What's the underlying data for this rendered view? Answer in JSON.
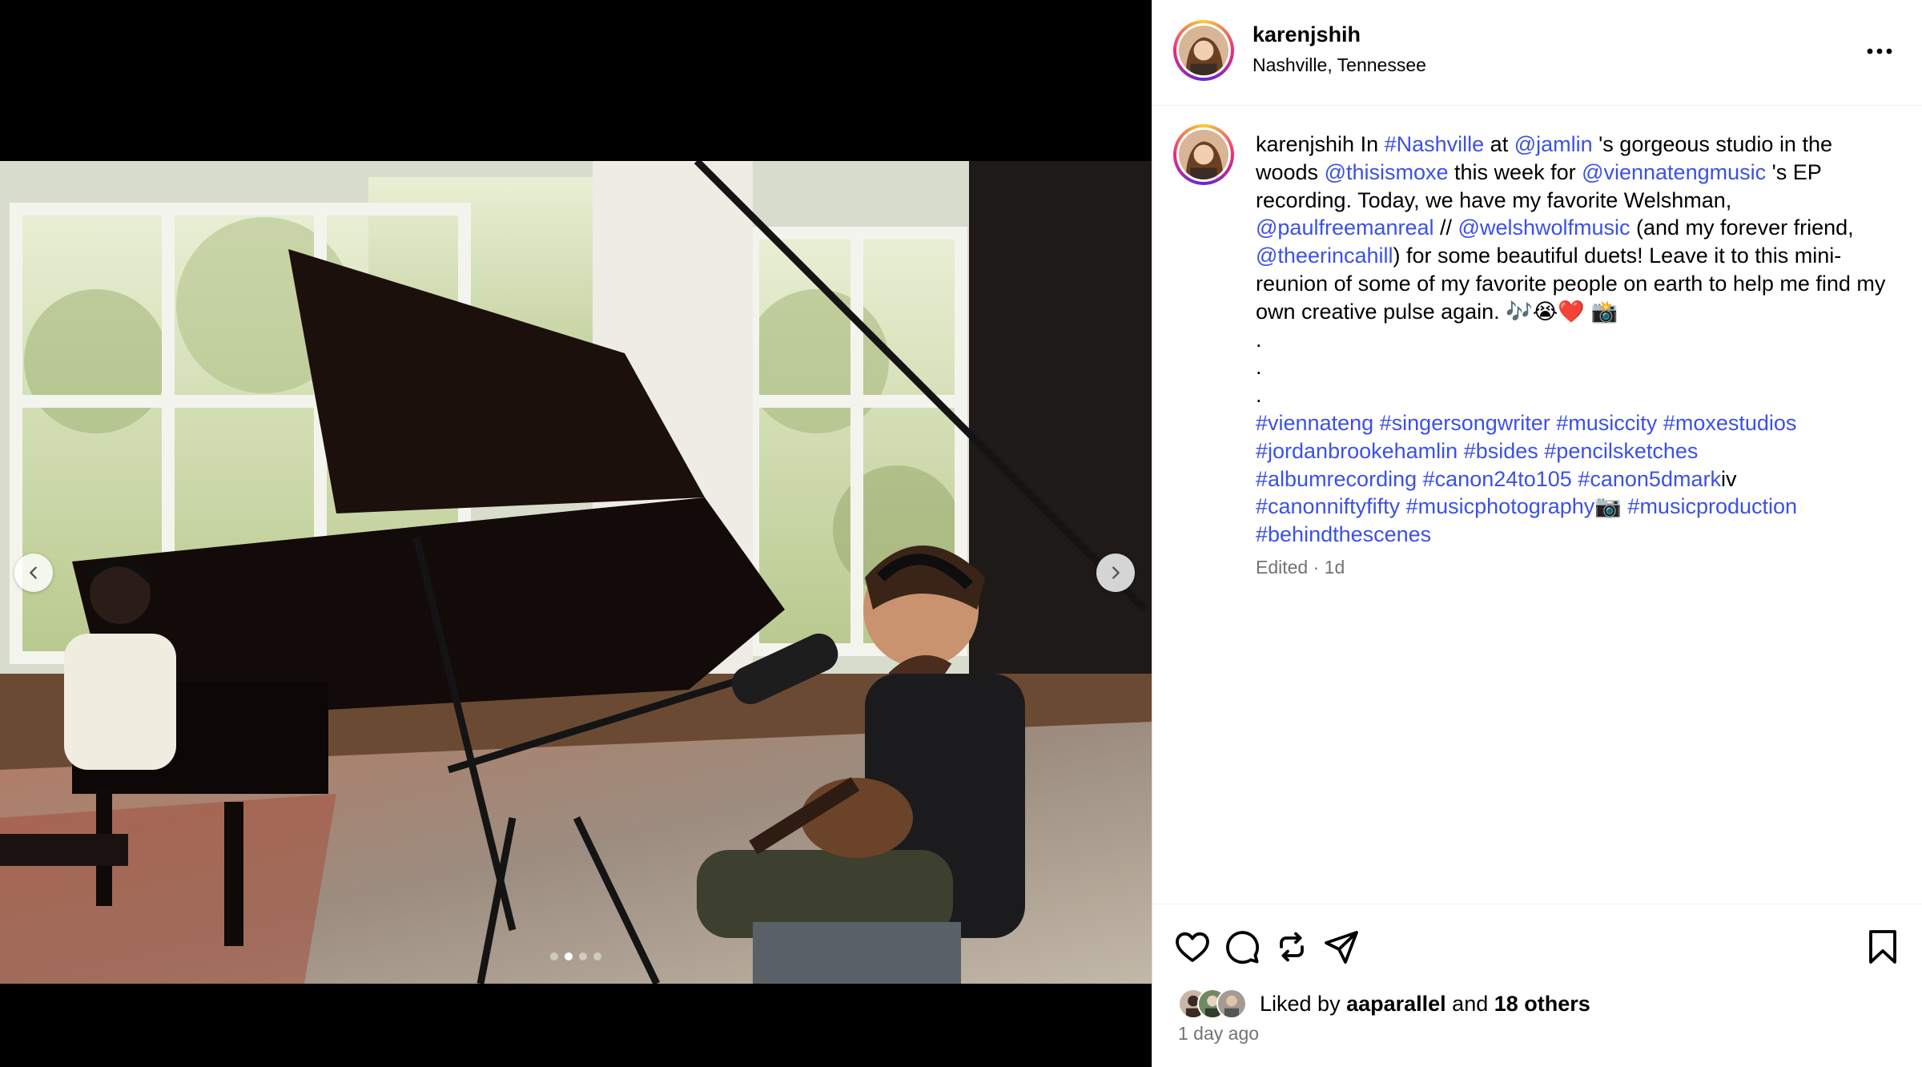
{
  "post": {
    "author": "karenjshih",
    "location": "Nashville, Tennessee"
  },
  "icons": {
    "more": "more-horizontal-icon",
    "prev": "chevron-left-icon",
    "next": "chevron-right-icon",
    "like": "heart-icon",
    "comment": "comment-icon",
    "repost": "repost-icon",
    "share": "send-icon",
    "save": "bookmark-icon"
  },
  "carousel": {
    "current_index": 1,
    "total": 4
  },
  "caption": {
    "username": "karenjshih",
    "t1": " In ",
    "h_nashville": "#Nashville",
    "t2": " at ",
    "m_jamlin": "@jamlin",
    "t3": " 's gorgeous studio in the woods ",
    "m_thisismoxe": "@thisismoxe",
    "t4": " this week for ",
    "m_viennatengmusic": "@viennatengmusic",
    "t5": " 's EP recording. Today, we have my favorite Welshman, ",
    "m_paulfreemanreal": "@paulfreemanreal",
    "t6": " // ",
    "m_welshwolfmusic": "@welshwolfmusic",
    "t7": " (and my forever friend, ",
    "m_theerincahill": "@theerincahill",
    "t8": ") for some beautiful duets! Leave it to this mini-reunion of some of my favorite people on earth to help me find my own creative pulse again. 🎶😭❤️ 📸",
    "dot": ".",
    "tags_line1": [
      "#viennateng",
      "#singersongwriter",
      "#musiccity",
      "#moxestudios"
    ],
    "tags_line2": [
      "#jordanbrookehamlin",
      "#bsides",
      "#pencilsketches"
    ],
    "tags_line3": [
      "#albumrecording",
      "#canon24to105",
      "#canon5dmark"
    ],
    "tags_line3_suffix": "iv",
    "tags_line4": [
      "#canonniftyfifty",
      "#musicphotography"
    ],
    "tags_line4_emoji": "📷",
    "tags_line4_b": [
      "#musicproduction"
    ],
    "tags_line5": [
      "#behindthescenes"
    ]
  },
  "meta": {
    "edited": "Edited",
    "sep": " · ",
    "age": "1d"
  },
  "likes": {
    "prefix": "Liked by ",
    "user": "aaparallel",
    "middle": " and ",
    "others": "18 others"
  },
  "posted": "1 day ago"
}
